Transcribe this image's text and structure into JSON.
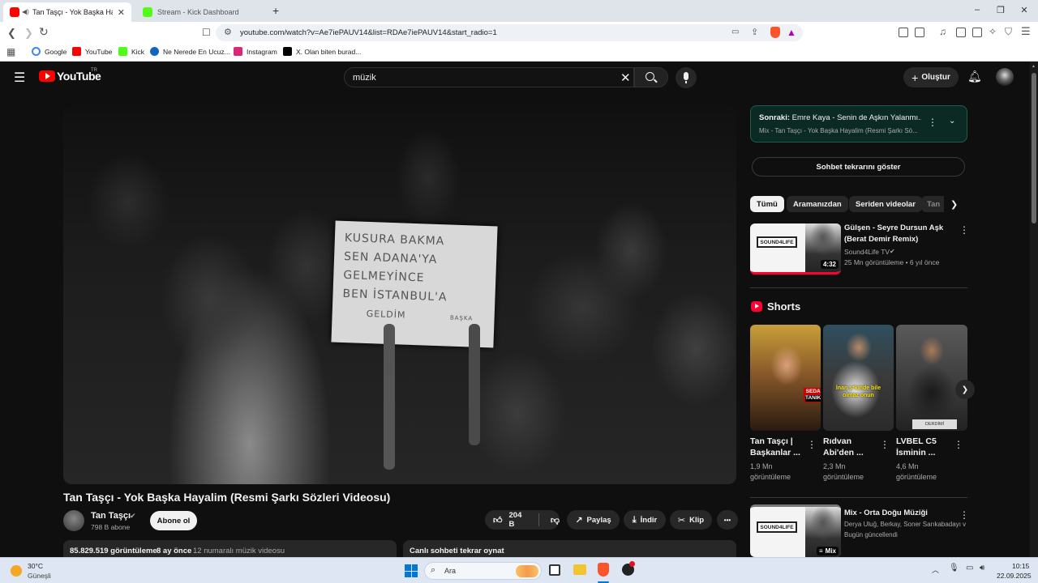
{
  "browser": {
    "tabs": [
      {
        "label": "Tan Taşçı - Yok Başka Hayalim",
        "close": "✕"
      },
      {
        "label": "Stream - Kick Dashboard"
      }
    ],
    "new_tab": "+",
    "window": {
      "minimize": "–",
      "restore": "❐",
      "close": "✕"
    },
    "url": "youtube.com/watch?v=Ae7iePAUV14&list=RDAe7iePAUV14&start_radio=1",
    "bookmarks": [
      {
        "label": "Google",
        "color": "#4285f4"
      },
      {
        "label": "YouTube",
        "color": "#ff0000"
      },
      {
        "label": "Kick",
        "color": "#53fc18"
      },
      {
        "label": "Ne Nerede En Ucuz...",
        "color": "#1565c0"
      },
      {
        "label": "Instagram",
        "color": "#d62976"
      },
      {
        "label": "X. Olan biten burad...",
        "color": "#000000"
      }
    ]
  },
  "youtube": {
    "logo": "YouTube",
    "logo_region": "TR",
    "search_value": "müzik",
    "create_label": "Oluştur",
    "video": {
      "sign_lines": [
        "KUSURA BAKMA",
        "SEN ADANA'YA",
        "GELMEYİNCE",
        "BEN İSTANBUL'A",
        "GELDİM",
        "BAŞKA"
      ],
      "title": "Tan Taşçı - Yok Başka Hayalim (Resmi Şarkı Sözleri Videosu)",
      "channel": "Tan Taşçı",
      "subscribers": "798 B abone",
      "subscribe": "Abone ol",
      "likes": "204 B",
      "share": "Paylaş",
      "download": "İndir",
      "clip": "Klip",
      "more": "•••",
      "views": "85.829.519 görüntüleme",
      "age": "8 ay önce",
      "tag": "12 numaralı müzik videosu",
      "live_chat_replay": "Canlı sohbeti tekrar oynat"
    },
    "sidebar": {
      "next_prefix": "Sonraki:",
      "next_title": "Emre Kaya - Senin de Aşkın Yalanmı...",
      "next_sub": "Mix - Tan Taşçı - Yok Başka Hayalim (Resmi Şarkı Sö...",
      "chat_replay": "Sohbet tekrarını göster",
      "chips": [
        "Tümü",
        "Aramanızdan",
        "Seriden videolar",
        "Tan"
      ],
      "rec1": {
        "title_l1": "Gülşen - Seyre Dursun Aşk",
        "title_l2": "(Berat Demir Remix)",
        "channel": "Sound4Life TV",
        "meta": "25 Mn görüntüleme • 6 yıl önce",
        "duration": "4:32",
        "thumb_logo": "SOUND4LIFE"
      },
      "shorts_title": "Shorts",
      "shorts": [
        {
          "t1": "Tan Taşçı |",
          "t2": "Başkanlar ...",
          "v1": "1,9 Mn",
          "v2": "görüntüleme",
          "overlay1": "SEDA",
          "overlay2": "TANIK"
        },
        {
          "t1": "Rıdvan",
          "t2": "Abi'den ...",
          "v1": "2,3 Mn",
          "v2": "görüntüleme",
          "overlay1": "İnan s*kinde bile",
          "overlay2": "olmaz onun"
        },
        {
          "t1": "LVBEL C5",
          "t2": "İsminin ...",
          "v1": "4,6 Mn",
          "v2": "görüntüleme",
          "overlay1": "DERDİMİ",
          "overlay2": ""
        }
      ],
      "mix": {
        "title": "Mix - Orta Doğu Müziği",
        "sub": "Derya Uluğ, Berkay, Soner Sarıkabadayı v...",
        "meta": "Bugün güncellendi",
        "badge": "Mix",
        "thumb_logo": "SOUND4LIFE"
      }
    }
  },
  "taskbar": {
    "temp": "30°C",
    "weather": "Güneşli",
    "search": "Ara",
    "time": "10:15",
    "date": "22.09.2025"
  }
}
